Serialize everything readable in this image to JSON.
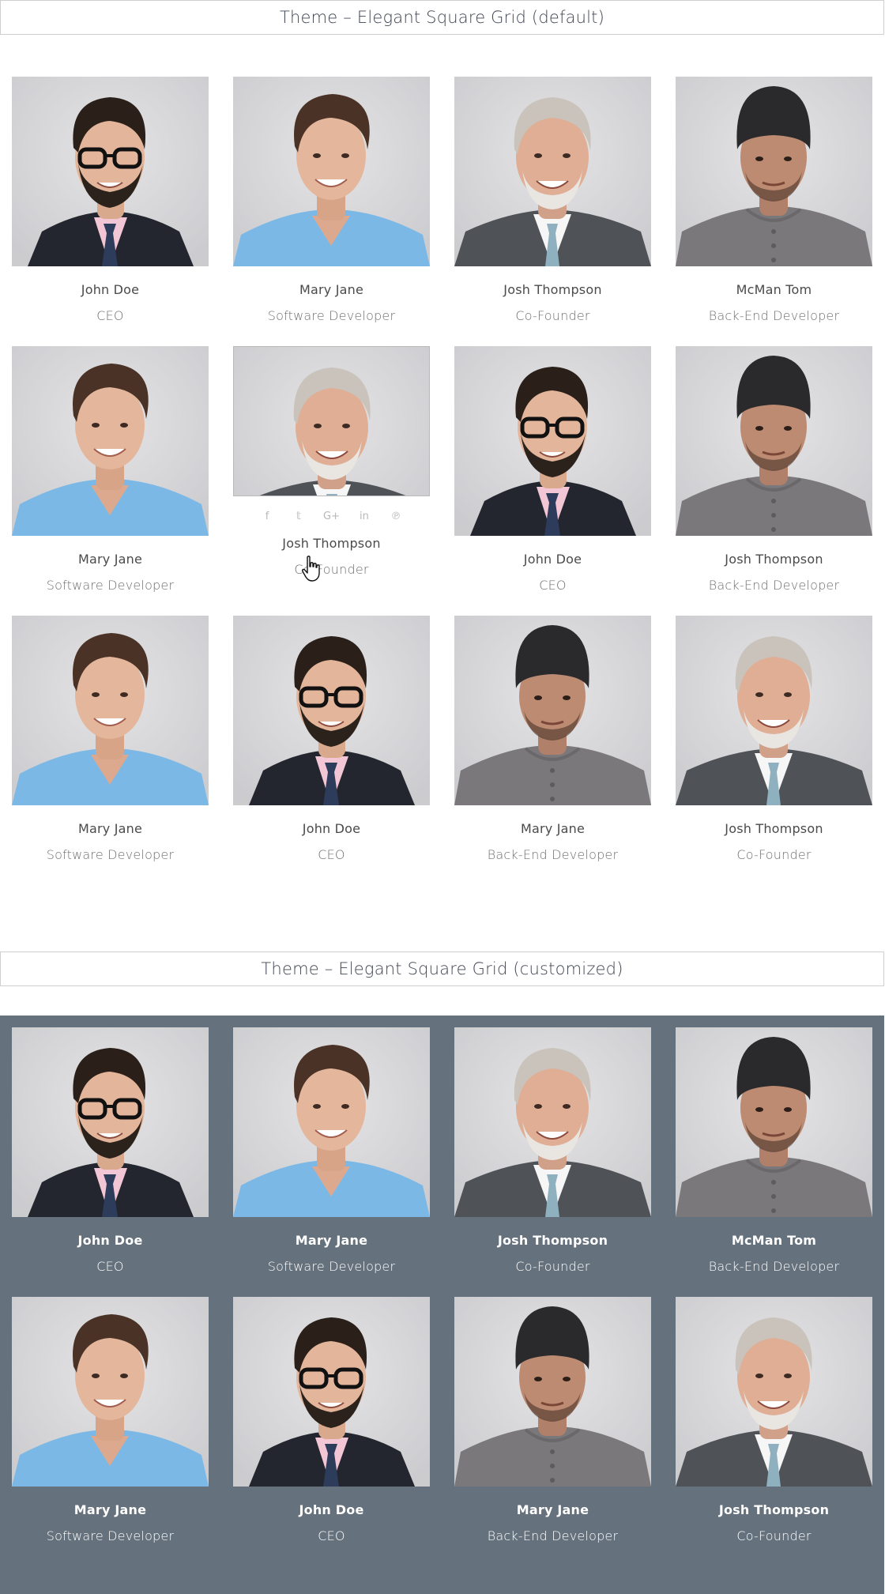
{
  "default_section": {
    "title": "Theme – Elegant Square Grid (default)",
    "members": [
      {
        "name": "John Doe",
        "role": "CEO",
        "photo": "man-glasses-beard-photo"
      },
      {
        "name": "Mary Jane",
        "role": "Software Developer",
        "photo": "young-man-blue-shirt-photo"
      },
      {
        "name": "Josh Thompson",
        "role": "Co-Founder",
        "photo": "grey-haired-man-suit-photo"
      },
      {
        "name": "McMan Tom",
        "role": "Back-End Developer",
        "photo": "man-beanie-photo"
      },
      {
        "name": "Mary Jane",
        "role": "Software Developer",
        "photo": "young-man-blue-shirt-photo"
      },
      {
        "name": "Josh Thompson",
        "role": "Co-Founder",
        "photo": "grey-haired-man-suit-photo",
        "hover": true
      },
      {
        "name": "John Doe",
        "role": "CEO",
        "photo": "man-glasses-beard-photo"
      },
      {
        "name": "Josh Thompson",
        "role": "Back-End Developer",
        "photo": "man-beanie-photo"
      },
      {
        "name": "Mary Jane",
        "role": "Software Developer",
        "photo": "young-man-blue-shirt-photo"
      },
      {
        "name": "John Doe",
        "role": "CEO",
        "photo": "man-glasses-beard-photo"
      },
      {
        "name": "Mary Jane",
        "role": "Back-End Developer",
        "photo": "man-beanie-photo"
      },
      {
        "name": "Josh Thompson",
        "role": "Co-Founder",
        "photo": "grey-haired-man-suit-photo"
      }
    ],
    "social_icons": [
      {
        "icon": "facebook-icon",
        "glyph": "f"
      },
      {
        "icon": "twitter-icon",
        "glyph": "𝕥"
      },
      {
        "icon": "google-plus-icon",
        "glyph": "G+"
      },
      {
        "icon": "linkedin-icon",
        "glyph": "in"
      },
      {
        "icon": "pinterest-icon",
        "glyph": "℗"
      }
    ]
  },
  "custom_section": {
    "title": "Theme – Elegant Square Grid (customized)",
    "background": "#65717c",
    "members": [
      {
        "name": "John Doe",
        "role": "CEO",
        "photo": "man-glasses-beard-photo"
      },
      {
        "name": "Mary Jane",
        "role": "Software Developer",
        "photo": "young-man-blue-shirt-photo"
      },
      {
        "name": "Josh Thompson",
        "role": "Co-Founder",
        "photo": "grey-haired-man-suit-photo"
      },
      {
        "name": "McMan Tom",
        "role": "Back-End Developer",
        "photo": "man-beanie-photo"
      },
      {
        "name": "Mary Jane",
        "role": "Software Developer",
        "photo": "young-man-blue-shirt-photo"
      },
      {
        "name": "John Doe",
        "role": "CEO",
        "photo": "man-glasses-beard-photo"
      },
      {
        "name": "Mary Jane",
        "role": "Back-End Developer",
        "photo": "man-beanie-photo"
      },
      {
        "name": "Josh Thompson",
        "role": "Co-Founder",
        "photo": "grey-haired-man-suit-photo"
      }
    ]
  }
}
